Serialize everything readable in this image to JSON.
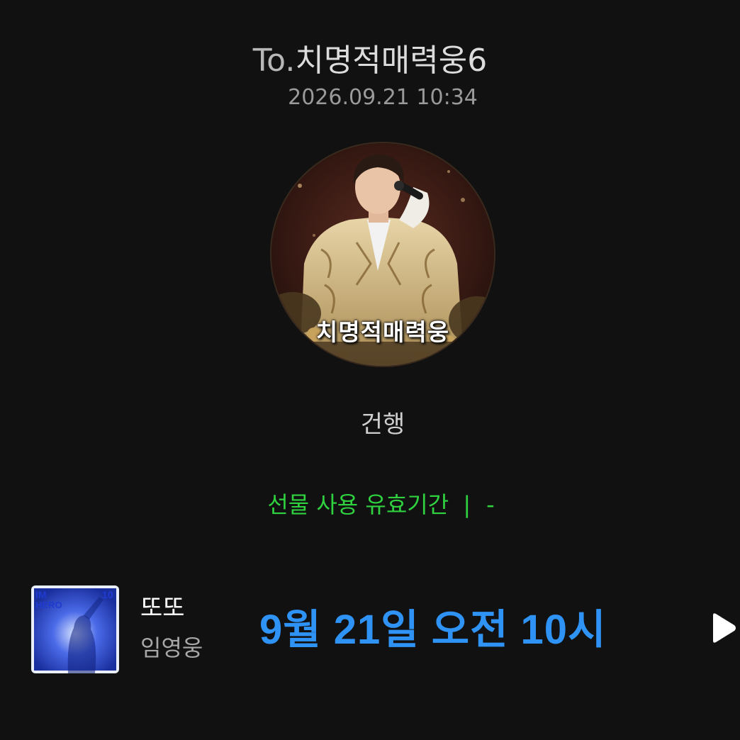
{
  "message": {
    "recipient_prefix": "To.",
    "recipient_name": "치명적매력웅6",
    "timestamp": "2026.09.21 10:34",
    "profile_caption": "치명적매력웅",
    "sender": "건행",
    "validity_label": "선물 사용 유효기간",
    "validity_separator": "|",
    "validity_value": "-"
  },
  "song": {
    "title": "또또",
    "artist": "임영웅",
    "album_art_text_left": "IM\nHERO",
    "album_art_text_right": "10",
    "schedule_note": "9월 21일 오전 10시"
  },
  "icons": {
    "play": "play-icon"
  },
  "colors": {
    "background": "#111111",
    "validity_green": "#2fd13f",
    "schedule_blue": "#2e93f4"
  }
}
